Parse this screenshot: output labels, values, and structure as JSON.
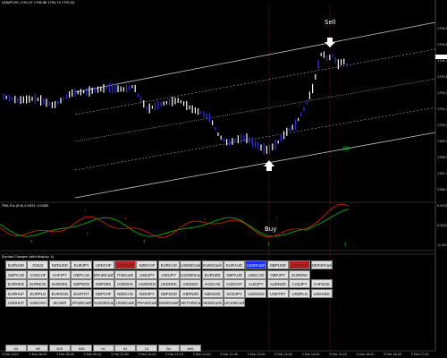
{
  "main_header": "USDJPY,M1  1791.02 1796.66 1790.70 1792.00",
  "indicator_header": "TMA Trix (6.6) 0.0032 -0.0083",
  "panel3_header": "Symbol Changer (with display: 4)",
  "annotations": {
    "sell": "Sell",
    "buy": "Buy",
    "watermark": "t2"
  },
  "price_ticks": [
    "1796.95",
    "1795.80",
    "1794.75",
    "1793.60",
    "1792.50",
    "1791.40",
    "1790.30",
    "1789.50",
    "1788.50",
    "1787.40",
    "1786.35"
  ],
  "indicator_ticks": [
    "0.0028",
    "0.0000",
    "-0.0028"
  ],
  "time_ticks": [
    "3 Feb 2022",
    "3 Feb 08:00",
    "3 Feb 08:40",
    "3 Feb 09:20",
    "3 Feb 10:00",
    "3 Feb 10:40",
    "3 Feb 11:20",
    "3 Feb 12:00",
    "3 Feb 12:40",
    "3 Feb 13:20",
    "3 Feb 14:00",
    "3 Feb 14:40",
    "3 Feb 15:20",
    "3 Feb 16:00",
    "3 Feb 16:40",
    "3 Feb 17:20"
  ],
  "symbol_grid": [
    [
      "EURUSD",
      "GOLD",
      "NZDUSD",
      "EURJPY",
      "USDCHF",
      "XAGEUR",
      "NZDCHF",
      "EURCAD",
      "US500Cash",
      "EU50Cash",
      "EURAUD",
      "US30Cash",
      "GBPUSD",
      "EURCHF",
      "GER40Cash"
    ],
    [
      "GBPCAD",
      "CADCHF",
      "CHFJPY",
      "GBPCAD",
      "SPA35Cash",
      "IT40Cash",
      "USDJPY",
      "USDJPY",
      "US2000Cash",
      "EURNZD",
      "GBPAUD",
      "USDCAD",
      "GBPJPY",
      "EURDKK"
    ],
    [
      "EURHKD",
      "EURNOK",
      "EURSEK",
      "GBPNOK",
      "GBPSEK",
      "USDDKK",
      "USDMXN",
      "USDNOK",
      "USDSEK",
      "AUDCAD",
      "AUDCHF",
      "AUDJPY",
      "AUDNZD",
      "CADJPY",
      "CHFSGD"
    ],
    [
      "EURHUF",
      "EURPLN",
      "EURSGD",
      "EURTRY",
      "GBPCHF",
      "NZDCAD",
      "NZDJPY",
      "GBPSGD",
      "GBPNZD",
      "NZDSGD",
      "SGDJPY",
      "USDSGD",
      "USDTRY",
      "USDPLN",
      "USDHKD"
    ],
    [
      "USDHUF",
      "USDCNH",
      "SILVER",
      "JP225Cash",
      "AUS200Cash",
      "US30Cash",
      "FRA40Cash",
      "SWI20Cash",
      "NETH25Cash",
      "HK50Cash",
      "UK100Cash"
    ]
  ],
  "symbol_colors": {
    "red": "#b42121",
    "blue": "#1430ff"
  },
  "highlight": {
    "red": [
      "XAGEUR",
      "EURCHF"
    ],
    "blue": [
      "US30Cash"
    ]
  },
  "timeframes": [
    "M1",
    "M5",
    "M15",
    "M30",
    "H1",
    "H4",
    "D1",
    "W1",
    "MN1"
  ],
  "colors": {
    "background": "#000000",
    "bull": "#2d2df0",
    "bear": "#ffffff",
    "channel": "#c8c8c8",
    "channel_mid": "#d0d0d0",
    "trix_main": "#cc2200",
    "trix_signal": "#00b000",
    "vline": "#8b1a1a"
  }
}
